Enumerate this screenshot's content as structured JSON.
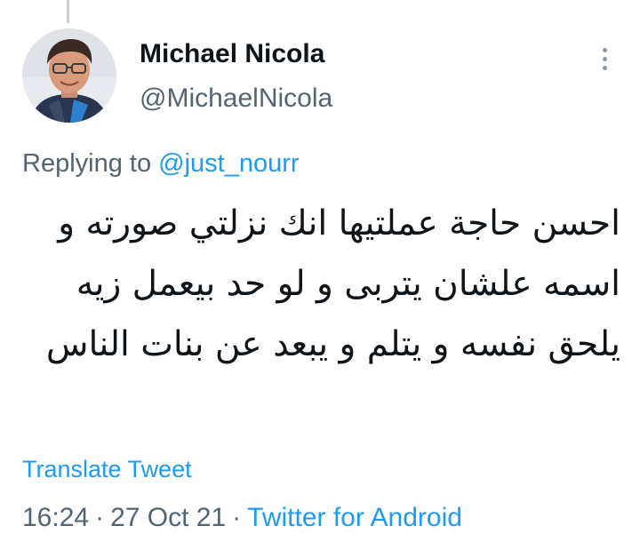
{
  "tweet": {
    "author": {
      "name": "Michael Nicola",
      "handle": "@MichaelNicola"
    },
    "reply": {
      "prefix": "Replying to ",
      "mention": "@just_nourr"
    },
    "text": "احسن حاجة عملتيها انك نزلتي صورته و اسمه علشان يتربى و لو حد بيعمل زيه يلحق نفسه و يتلم و يبعد عن بنات الناس",
    "translate_label": "Translate Tweet",
    "meta": {
      "time": "16:24",
      "separator": "·",
      "date": "27 Oct 21",
      "source": "Twitter for Android"
    },
    "icons": {
      "more": "more-vertical-icon"
    },
    "colors": {
      "link": "#1d9bf0",
      "secondary_text": "#536471",
      "primary_text": "#0f1419"
    }
  }
}
